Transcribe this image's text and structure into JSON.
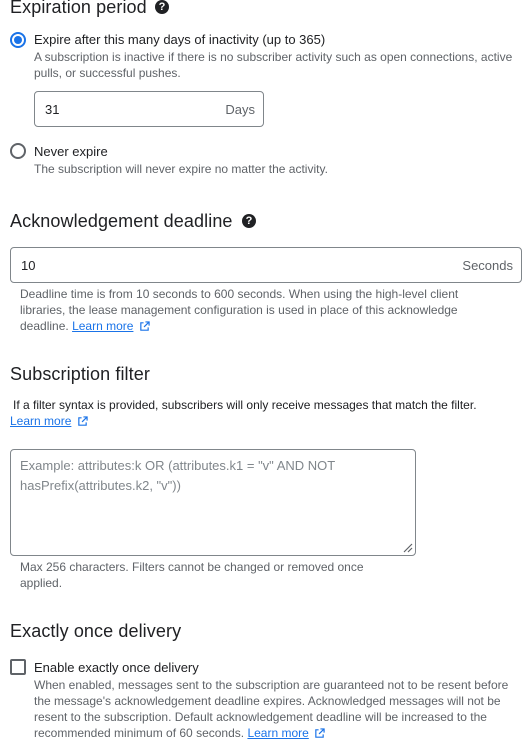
{
  "expiration": {
    "title": "Expiration period",
    "help_icon": "?",
    "option_expire": {
      "label": "Expire after this many days of inactivity (up to 365)",
      "helper": "A subscription is inactive if there is no subscriber activity such as open connections, active pulls, or successful pushes.",
      "selected": true
    },
    "days_field": {
      "value": "31",
      "suffix": "Days"
    },
    "option_never": {
      "label": "Never expire",
      "helper": "The subscription will never expire no matter the activity.",
      "selected": false
    }
  },
  "ack": {
    "title": "Acknowledgement deadline",
    "help_icon": "?",
    "field": {
      "value": "10",
      "suffix": "Seconds"
    },
    "helper_line1": "Deadline time is from 10 seconds to 600 seconds. When using the high-level client",
    "helper_line2": "libraries, the lease management configuration is used in place of this acknowledge",
    "helper_line3": "deadline.",
    "learn_more": "Learn more"
  },
  "filter": {
    "title": "Subscription filter",
    "description": "If a filter syntax is provided, subscribers will only receive messages that match the filter.",
    "learn_more": "Learn more",
    "placeholder_line1": "Example: attributes:k OR (attributes.k1 = \"v\" AND NOT",
    "placeholder_line2": "hasPrefix(attributes.k2, \"v\"))",
    "helper_line1": "Max 256 characters. Filters cannot be changed or removed once",
    "helper_line2": "applied."
  },
  "exactly_once": {
    "title": "Exactly once delivery",
    "checkbox_label": "Enable exactly once delivery",
    "checked": false,
    "helper_line1": "When enabled, messages sent to the subscription are guaranteed not to be resent before",
    "helper_line2": "the message's acknowledgement deadline expires. Acknowledged messages will not be",
    "helper_line3": "resent to the subscription. Default acknowledgement deadline will be increased to the",
    "helper_line4": "recommended minimum of 60 seconds.",
    "learn_more": "Learn more"
  },
  "colors": {
    "accent": "#1a73e8",
    "text": "#202124",
    "secondary_text": "#5f6368",
    "border": "#80868b"
  }
}
